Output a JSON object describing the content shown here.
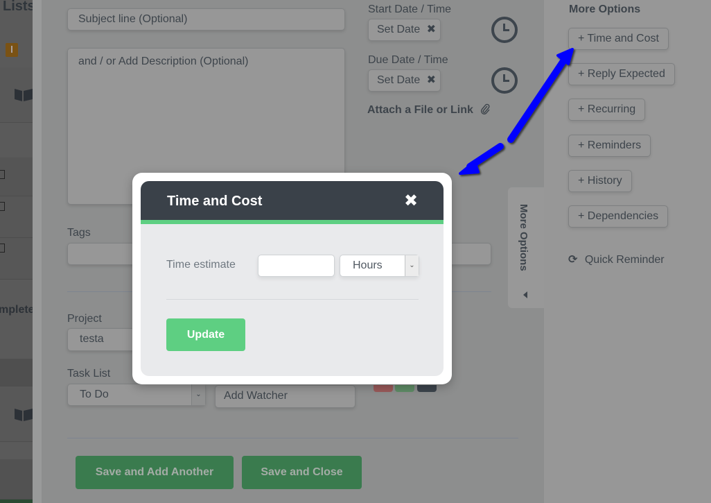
{
  "background_app": {
    "lists_title": "Lists",
    "completed_label": "mpleted"
  },
  "task_form": {
    "subject_placeholder": "Subject line (Optional)",
    "description_placeholder": "and / or Add Description (Optional)",
    "start_date_label": "Start Date / Time",
    "start_date_button": "Set Date",
    "due_date_label": "Due Date / Time",
    "due_date_button": "Set Date",
    "clear_icon_glyph": "✖",
    "attach_label": "Attach a File or Link",
    "attach_icon_glyph": "📎",
    "tags_label": "Tags",
    "tags_value": "",
    "project_label": "Project",
    "project_value": "testa",
    "task_list_label": "Task List",
    "task_list_value": "To Do",
    "watcher_placeholder": "Add Watcher",
    "priority_colors": [
      "#9a5a5a",
      "#5f8c66",
      "#3d454d"
    ],
    "more_options_tab": "More Options",
    "save_add_another": "Save and Add Another",
    "save_close": "Save and Close"
  },
  "more_options": {
    "title": "More Options",
    "buttons": [
      {
        "label": "+ Time and Cost"
      },
      {
        "label": "+ Reply Expected"
      },
      {
        "label": "+ Recurring"
      },
      {
        "label": "+ Reminders"
      },
      {
        "label": "+ History"
      },
      {
        "label": "+ Dependencies"
      }
    ],
    "quick_reminder": "Quick Reminder",
    "quick_reminder_icon": "⟳"
  },
  "modal": {
    "title": "Time and Cost",
    "close_glyph": "✖",
    "time_estimate_label": "Time estimate",
    "time_estimate_value": "",
    "unit_selected": "Hours",
    "update_label": "Update",
    "accent_color": "#5ecf82",
    "header_color": "#3a4149"
  },
  "annotation": {
    "arrow_color": "#0000ff"
  }
}
